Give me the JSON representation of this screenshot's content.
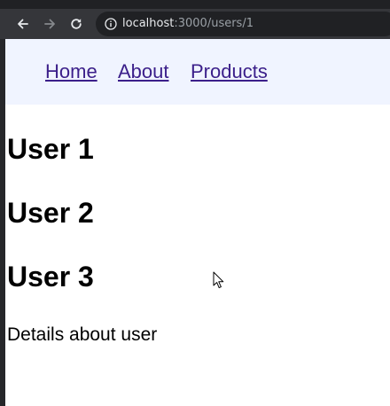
{
  "browser": {
    "url_host": "localhost",
    "url_path": ":3000/users/1"
  },
  "nav": {
    "links": [
      {
        "label": "Home"
      },
      {
        "label": "About"
      },
      {
        "label": "Products"
      }
    ]
  },
  "users": [
    {
      "heading": "User 1"
    },
    {
      "heading": "User 2"
    },
    {
      "heading": "User 3"
    }
  ],
  "details_text": "Details about user"
}
